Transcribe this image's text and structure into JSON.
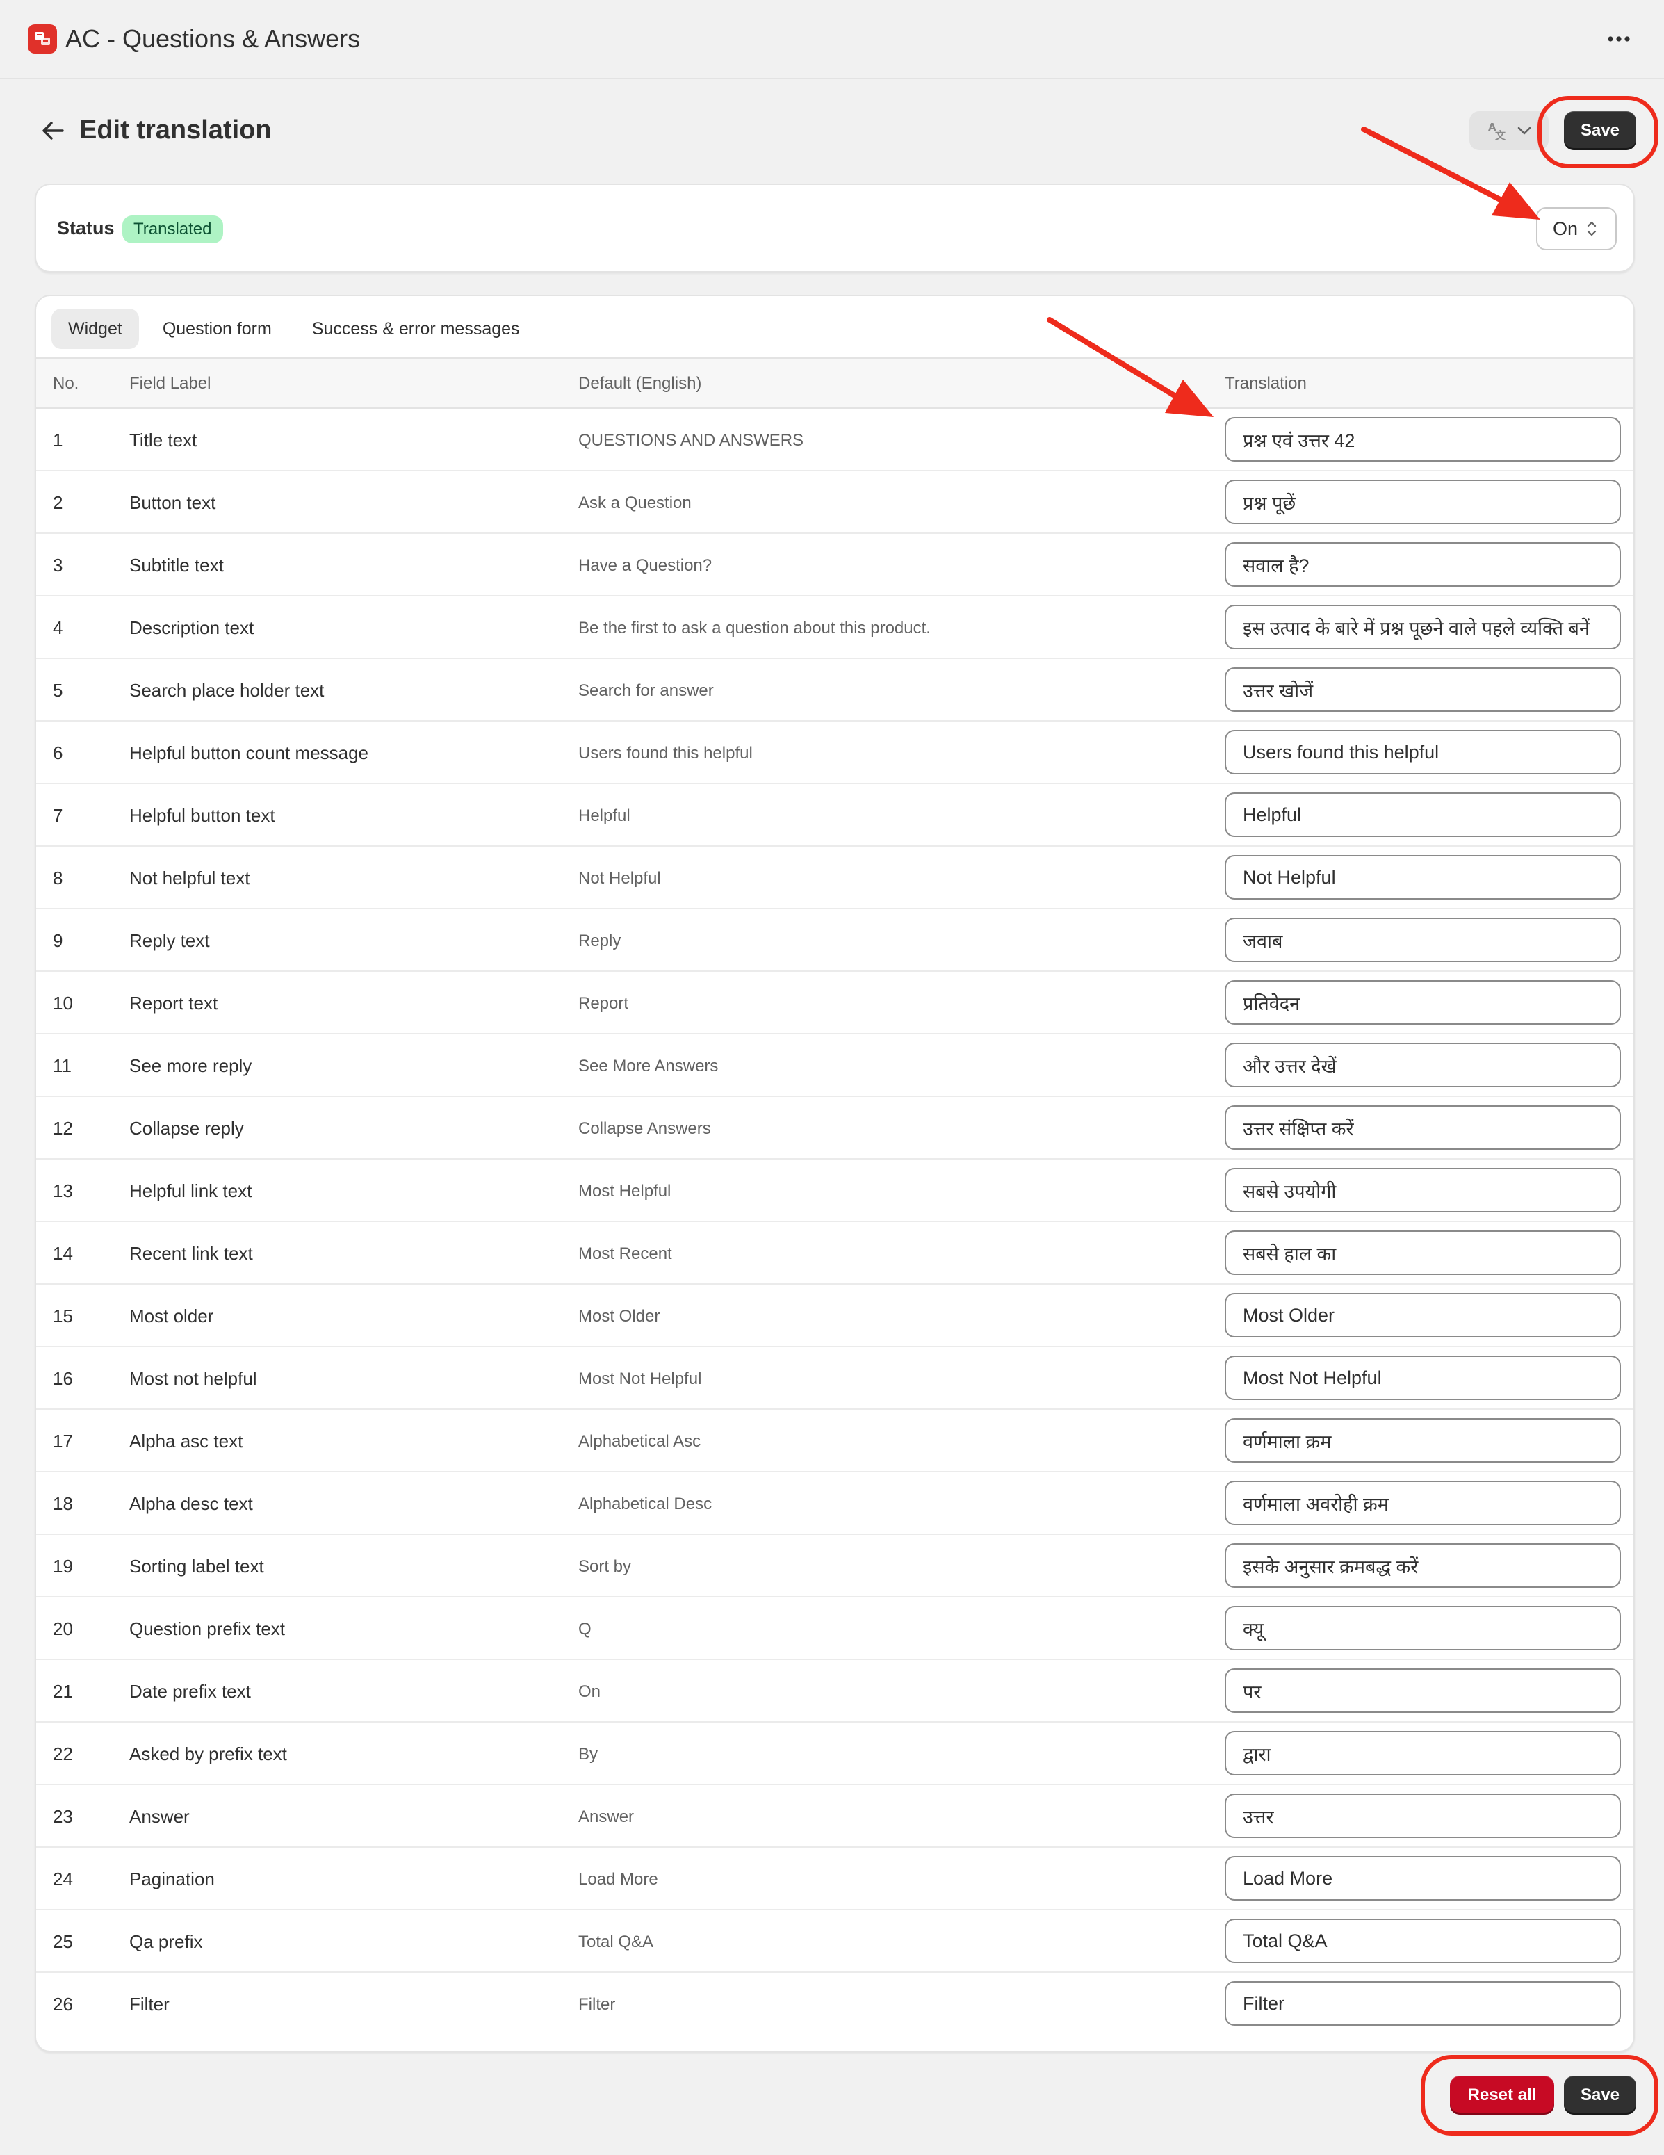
{
  "app": {
    "title": "AC - Questions & Answers"
  },
  "header": {
    "title": "Edit translation",
    "save_label": "Save"
  },
  "status": {
    "label": "Status",
    "badge": "Translated",
    "toggle_value": "On"
  },
  "tabs": [
    {
      "label": "Widget",
      "active": true
    },
    {
      "label": "Question form",
      "active": false
    },
    {
      "label": "Success & error messages",
      "active": false
    }
  ],
  "table": {
    "headers": {
      "no": "No.",
      "label": "Field Label",
      "default": "Default (English)",
      "translation": "Translation"
    },
    "rows": [
      {
        "no": "1",
        "label": "Title text",
        "default": "QUESTIONS AND ANSWERS",
        "translation": "प्रश्न एवं उत्तर 42"
      },
      {
        "no": "2",
        "label": "Button text",
        "default": "Ask a Question",
        "translation": "प्रश्न पूछें"
      },
      {
        "no": "3",
        "label": "Subtitle text",
        "default": "Have a Question?",
        "translation": "सवाल है?"
      },
      {
        "no": "4",
        "label": "Description text",
        "default": "Be the first to ask a question about this product.",
        "translation": "इस उत्पाद के बारे में प्रश्न पूछने वाले पहले व्यक्ति बनें"
      },
      {
        "no": "5",
        "label": "Search place holder text",
        "default": "Search for answer",
        "translation": "उत्तर खोजें"
      },
      {
        "no": "6",
        "label": "Helpful button count message",
        "default": "Users found this helpful",
        "translation": "Users found this helpful"
      },
      {
        "no": "7",
        "label": "Helpful button text",
        "default": "Helpful",
        "translation": "Helpful"
      },
      {
        "no": "8",
        "label": "Not helpful text",
        "default": "Not Helpful",
        "translation": "Not Helpful"
      },
      {
        "no": "9",
        "label": "Reply text",
        "default": "Reply",
        "translation": "जवाब"
      },
      {
        "no": "10",
        "label": "Report text",
        "default": "Report",
        "translation": "प्रतिवेदन"
      },
      {
        "no": "11",
        "label": "See more reply",
        "default": "See More Answers",
        "translation": "और उत्तर देखें"
      },
      {
        "no": "12",
        "label": "Collapse reply",
        "default": "Collapse Answers",
        "translation": "उत्तर संक्षिप्त करें"
      },
      {
        "no": "13",
        "label": "Helpful link text",
        "default": "Most Helpful",
        "translation": "सबसे उपयोगी"
      },
      {
        "no": "14",
        "label": "Recent link text",
        "default": "Most Recent",
        "translation": "सबसे हाल का"
      },
      {
        "no": "15",
        "label": "Most older",
        "default": "Most Older",
        "translation": "Most Older"
      },
      {
        "no": "16",
        "label": "Most not helpful",
        "default": "Most Not Helpful",
        "translation": "Most Not Helpful"
      },
      {
        "no": "17",
        "label": "Alpha asc text",
        "default": "Alphabetical Asc",
        "translation": "वर्णमाला क्रम"
      },
      {
        "no": "18",
        "label": "Alpha desc text",
        "default": "Alphabetical Desc",
        "translation": "वर्णमाला अवरोही क्रम"
      },
      {
        "no": "19",
        "label": "Sorting label text",
        "default": "Sort by",
        "translation": "इसके अनुसार क्रमबद्ध करें"
      },
      {
        "no": "20",
        "label": "Question prefix text",
        "default": "Q",
        "translation": "क्यू"
      },
      {
        "no": "21",
        "label": "Date prefix text",
        "default": "On",
        "translation": "पर"
      },
      {
        "no": "22",
        "label": "Asked by prefix text",
        "default": "By",
        "translation": "द्वारा"
      },
      {
        "no": "23",
        "label": "Answer",
        "default": "Answer",
        "translation": "उत्तर"
      },
      {
        "no": "24",
        "label": "Pagination",
        "default": "Load More",
        "translation": "Load More"
      },
      {
        "no": "25",
        "label": "Qa prefix",
        "default": "Total Q&A",
        "translation": "Total Q&A"
      },
      {
        "no": "26",
        "label": "Filter",
        "default": "Filter",
        "translation": "Filter"
      }
    ]
  },
  "footer": {
    "reset_label": "Reset all",
    "save_label": "Save"
  },
  "colors": {
    "primary": "#303030",
    "critical": "#c70a24",
    "success_bg": "#aef3c4",
    "annotation": "#ee2b1c"
  }
}
